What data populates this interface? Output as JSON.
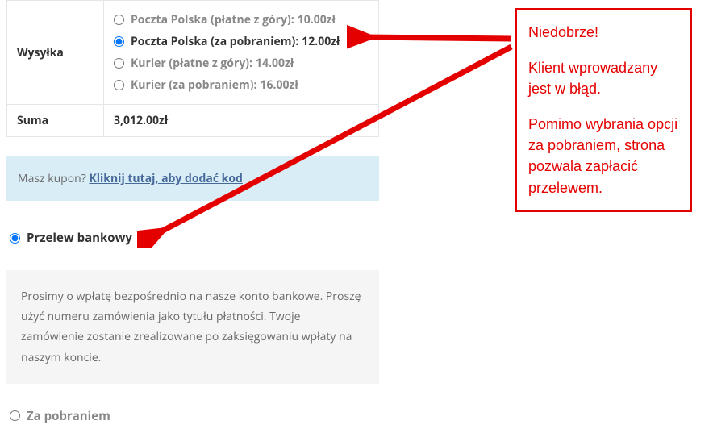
{
  "shipping": {
    "label": "Wysyłka",
    "options": [
      {
        "label": "Poczta Polska (płatne z góry):",
        "price": "10.00zł",
        "selected": false
      },
      {
        "label": "Poczta Polska (za pobraniem):",
        "price": "12.00zł",
        "selected": true
      },
      {
        "label": "Kurier (płatne z góry):",
        "price": "14.00zł",
        "selected": false
      },
      {
        "label": "Kurier (za pobraniem):",
        "price": "16.00zł",
        "selected": false
      }
    ]
  },
  "sum": {
    "label": "Suma",
    "value": "3,012.00zł"
  },
  "coupon": {
    "prompt": "Masz kupon?",
    "link": "Kliknij tutaj, aby dodać kod"
  },
  "payment": {
    "options": [
      {
        "label": "Przelew bankowy",
        "selected": true
      },
      {
        "label": "Za pobraniem",
        "selected": false
      }
    ],
    "description": "Prosimy o wpłatę bezpośrednio na nasze konto bankowe. Proszę użyć numeru zamówienia jako tytułu płatności. Twoje zamówienie zostanie zrealizowane po zaksięgowaniu wpłaty na naszym koncie."
  },
  "annotation": {
    "line1": "Niedobrze!",
    "line2": "Klient wprowadzany jest w błąd.",
    "line3": "Pomimo wybrania opcji za pobraniem, strona pozwala zapłacić przelewem."
  }
}
